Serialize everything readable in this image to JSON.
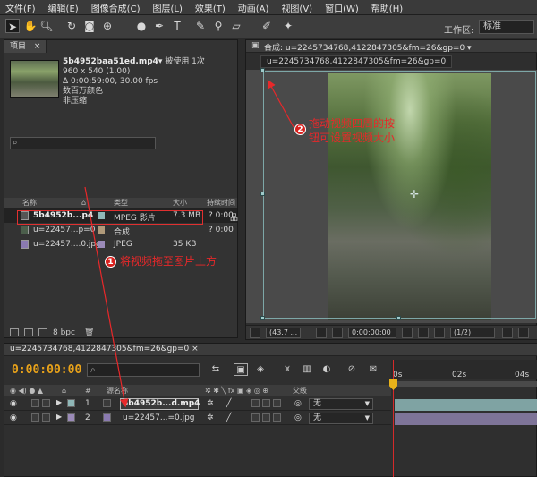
{
  "menu": [
    "文件(F)",
    "编辑(E)",
    "图像合成(C)",
    "图层(L)",
    "效果(T)",
    "动画(A)",
    "视图(V)",
    "窗口(W)",
    "帮助(H)"
  ],
  "toolbar": {
    "workspace_label": "工作区:",
    "workspace_value": "标准",
    "tools": [
      "selection-tool-icon",
      "hand-tool-icon",
      "zoom-tool-icon",
      "rotate-tool-icon",
      "camera-tool-icon",
      "pan-behind-tool-icon",
      "mask-tool-icon",
      "pen-tool-icon",
      "text-tool-icon",
      "brush-tool-icon",
      "clone-stamp-icon",
      "eraser-tool-icon",
      "roto-brush-icon",
      "puppet-pin-icon"
    ]
  },
  "project": {
    "tab": "项目",
    "tab_close": "×",
    "selected_name": "5b4952baa51ed.mp4▾",
    "usage": "被使用 1次",
    "dimensions": "960 x 540 (1.00)",
    "duration": "Δ 0:00:59:00, 30.00 fps",
    "colors": "数百万颜色",
    "compression": "非压缩",
    "search_icon": "⌕",
    "columns": [
      "名称",
      "类型",
      "大小",
      "持续时间"
    ],
    "items": [
      {
        "name": "5b4952b...p4",
        "type": "MPEG 影片",
        "size": "7.3 MB",
        "duration": "? 0:00",
        "label_color": "#8fb7b7"
      },
      {
        "name": "u=22457...p=0",
        "type": "合成",
        "size": "",
        "duration": "? 0:00",
        "label_color": "#b09a7a"
      },
      {
        "name": "u=22457....0.jpg",
        "type": "JPEG",
        "size": "35 KB",
        "duration": "",
        "label_color": "#9a8ab8"
      }
    ],
    "bpc": "8 bpc"
  },
  "composition": {
    "tab": "合成: u=2245734768,4122847305&fm=26&gp=0 ▾",
    "breadcrumb": "u=2245734768,4122847305&fm=26&gp=0",
    "zoom": "(43.7 ...",
    "timecode": "0:00:00:00",
    "resolution": "(1/2)"
  },
  "annotations": {
    "step1_number": "1",
    "step1_text": "将视频拖至图片上方",
    "step2_number": "2",
    "step2_text_line1": "拖动视频四周的按",
    "step2_text_line2": "钮可设置视频大小"
  },
  "timeline": {
    "tab": "u=2245734768,4122847305&fm=26&gp=0 ×",
    "current_time": "0:00:00:00",
    "search_icon": "⌕",
    "col_source": "源名称",
    "col_parent": "父级",
    "ruler": [
      "0s",
      "02s",
      "04s"
    ],
    "layers": [
      {
        "index": "1",
        "name": "5b4952b...d.mp4",
        "mode": "无",
        "label_color": "#8fb7b7"
      },
      {
        "index": "2",
        "name": "u=22457...=0.jpg",
        "mode": "无",
        "label_color": "#9a8ab8"
      }
    ]
  },
  "colors": {
    "accent": "#e8a21a",
    "annotation": "#e8282a",
    "playhead": "#d52a2a"
  }
}
